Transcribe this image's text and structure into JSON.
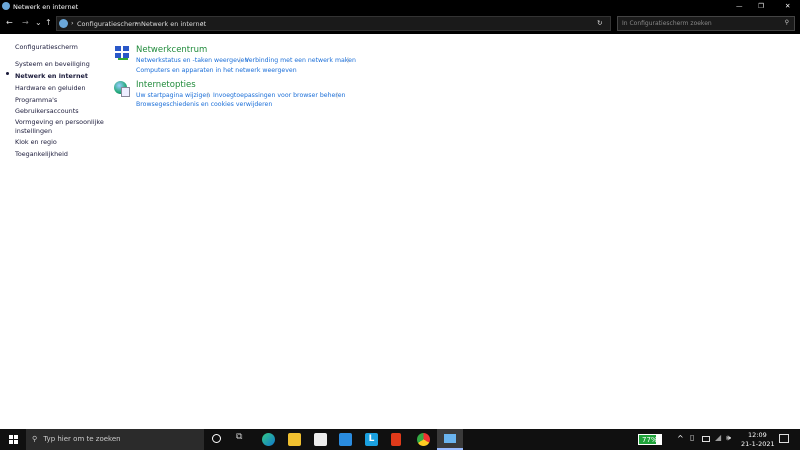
{
  "window": {
    "title": "Netwerk en internet",
    "minimize": "—",
    "maximize": "❐",
    "close": "✕"
  },
  "address": {
    "back": "←",
    "forward": "→",
    "recent": "⌄",
    "up": "↑",
    "crumbs": [
      "Configuratiescherm",
      "Netwerk en internet"
    ],
    "sep": "›",
    "refresh": "↻",
    "search_placeholder": "In Configuratiescherm zoeken"
  },
  "sidebar": {
    "home": "Configuratiescherm",
    "items": [
      {
        "label": "Systeem en beveiliging",
        "active": false
      },
      {
        "label": "Netwerk en internet",
        "active": true
      },
      {
        "label": "Hardware en geluiden",
        "active": false
      },
      {
        "label": "Programma's",
        "active": false
      },
      {
        "label": "Gebruikersaccounts",
        "active": false
      },
      {
        "label": "Vormgeving en persoonlijke instellingen",
        "active": false
      },
      {
        "label": "Klok en regio",
        "active": false
      },
      {
        "label": "Toegankelijkheid",
        "active": false
      }
    ]
  },
  "sections": [
    {
      "title": "Netwerkcentrum",
      "links": [
        "Netwerkstatus en -taken weergeven",
        "Verbinding met een netwerk maken",
        "Computers en apparaten in het netwerk weergeven"
      ]
    },
    {
      "title": "Internetopties",
      "links": [
        "Uw startpagina wijzigen",
        "Invoegtoepassingen voor browser beheren",
        "Browsegeschiedenis en cookies verwijderen"
      ]
    }
  ],
  "taskbar": {
    "search_placeholder": "Typ hier om te zoeken",
    "battery": "77%",
    "time": "12:09",
    "date": "21-1-2021"
  },
  "colors": {
    "link": "#1a6ed8",
    "heading": "#1f8a3a",
    "battery": "#1fa33a"
  }
}
